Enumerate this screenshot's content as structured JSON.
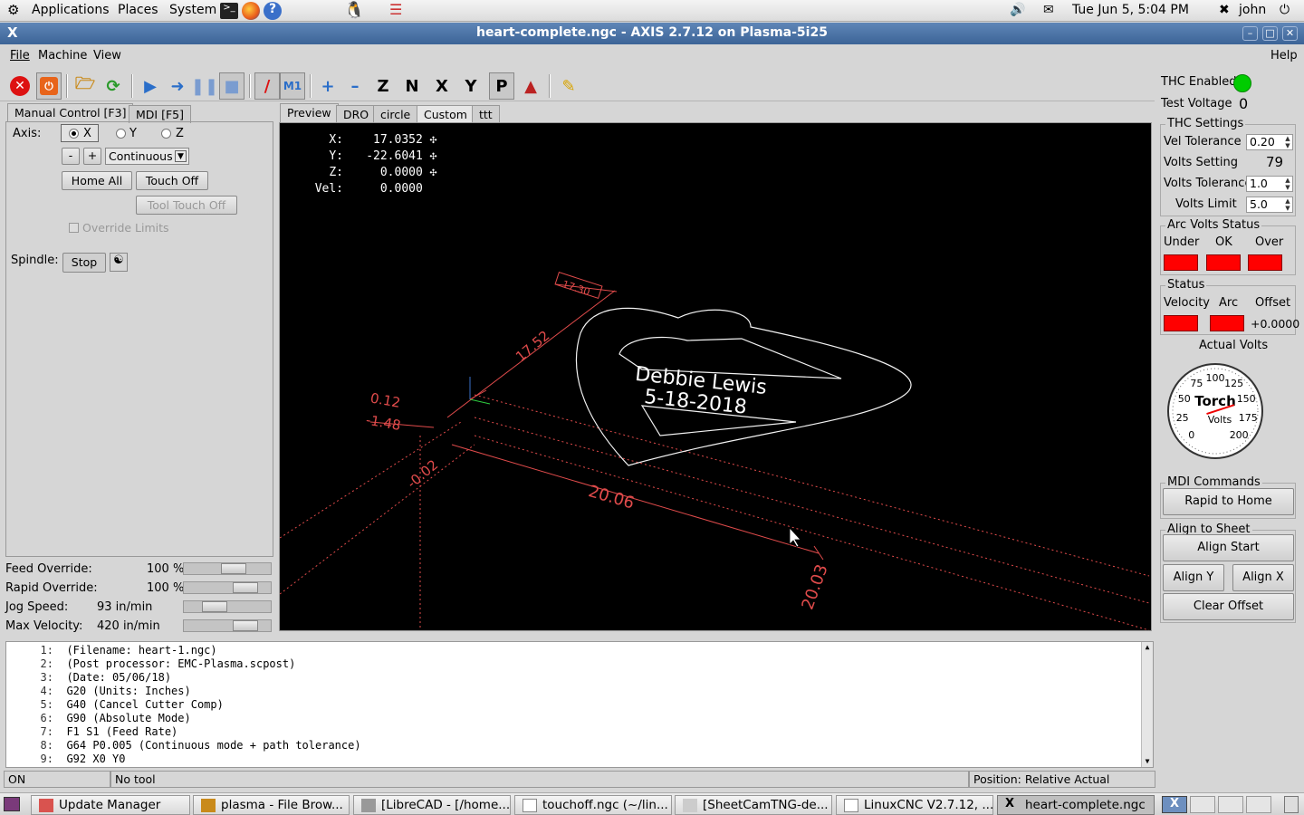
{
  "top_panel": {
    "menus": [
      "Applications",
      "Places",
      "System"
    ],
    "clock": "Tue Jun  5,  5:04 PM",
    "user": "john"
  },
  "window": {
    "title": "heart-complete.ngc - AXIS 2.7.12 on Plasma-5i25",
    "menu": [
      "File",
      "Machine",
      "View"
    ],
    "help": "Help"
  },
  "left_tabs": [
    "Manual Control [F3]",
    "MDI [F5]"
  ],
  "manual": {
    "axis_label": "Axis:",
    "axes": [
      "X",
      "Y",
      "Z"
    ],
    "minus": "-",
    "plus": "+",
    "jog_mode": "Continuous",
    "home_all": "Home All",
    "touch_off": "Touch Off",
    "tool_touch_off": "Tool Touch Off",
    "override_limits": "Override Limits",
    "spindle_label": "Spindle:",
    "spindle_stop": "Stop"
  },
  "sliders": [
    {
      "label": "Feed Override:",
      "value": "100 %",
      "level": 0.6
    },
    {
      "label": "Rapid Override:",
      "value": "100 %",
      "level": 0.8
    },
    {
      "label": "Jog Speed:",
      "value": "93 in/min",
      "level": 0.3
    },
    {
      "label": "Max Velocity:",
      "value": "420 in/min",
      "level": 0.8
    }
  ],
  "preview_tabs": [
    "Preview",
    "DRO",
    "circle",
    "Custom",
    "ttt"
  ],
  "dro": {
    "x_label": "X:",
    "x": "17.0352",
    "y_label": "Y:",
    "y": "-22.6041",
    "z_label": "Z:",
    "z": "0.0000",
    "vel_label": "Vel:",
    "vel": "0.0000"
  },
  "preview_text": {
    "line1": "Debbie Lewis",
    "line2": "5-18-2018",
    "dim_top": "17.30",
    "dim_side": "17.52",
    "dim_a": "0.12",
    "dim_b": "-1.48",
    "dim_c": "-0.02",
    "dim_x": "20.06",
    "dim_y": "20.03"
  },
  "gcode": [
    {
      "n": "1:",
      "t": "(Filename: heart-1.ngc)"
    },
    {
      "n": "2:",
      "t": "(Post processor: EMC-Plasma.scpost)"
    },
    {
      "n": "3:",
      "t": "(Date: 05/06/18)"
    },
    {
      "n": "4:",
      "t": "G20 (Units: Inches)"
    },
    {
      "n": "5:",
      "t": "G40 (Cancel Cutter Comp)"
    },
    {
      "n": "6:",
      "t": "G90 (Absolute Mode)"
    },
    {
      "n": "7:",
      "t": "F1 S1 (Feed Rate)"
    },
    {
      "n": "8:",
      "t": "G64 P0.005 (Continuous mode + path tolerance)"
    },
    {
      "n": "9:",
      "t": "G92 X0 Y0"
    }
  ],
  "status": {
    "state": "ON",
    "tool": "No tool",
    "position": "Position: Relative Actual"
  },
  "thc": {
    "enabled_label": "THC Enabled",
    "enabled_color": "#00cc00",
    "test_voltage_label": "Test Voltage",
    "test_voltage": "0",
    "settings_title": "THC Settings",
    "vel_tol_label": "Vel Tolerance",
    "vel_tol": "0.20",
    "volts_setting_label": "Volts Setting",
    "volts_setting": "79",
    "volts_tol_label": "Volts Tolerance",
    "volts_tol": "1.0",
    "volts_limit_label": "Volts Limit",
    "volts_limit": "5.0",
    "arc_status_title": "Arc Volts Status",
    "under": "Under",
    "ok": "OK",
    "over": "Over",
    "status_title": "Status",
    "velocity": "Velocity",
    "arc": "Arc",
    "offset": "Offset",
    "offset_value": "+0.0000",
    "actual_volts": "Actual Volts",
    "gauge_title": "Torch",
    "gauge_unit": "Volts",
    "gauge_ticks": [
      "0",
      "25",
      "50",
      "75",
      "100",
      "125",
      "150",
      "175",
      "200"
    ],
    "gauge_value": 20,
    "mdi_title": "MDI Commands",
    "rapid_home": "Rapid to Home",
    "align_title": "Align to Sheet",
    "align_start": "Align Start",
    "align_y": "Align Y",
    "align_x": "Align X",
    "clear_offset": "Clear Offset"
  },
  "taskbar": [
    "Update Manager",
    "plasma - File Brow...",
    "[LibreCAD - [/home...",
    "touchoff.ngc (~/lin...",
    "[SheetCamTNG-de...",
    "LinuxCNC V2.7.12, ...",
    "heart-complete.ngc"
  ]
}
